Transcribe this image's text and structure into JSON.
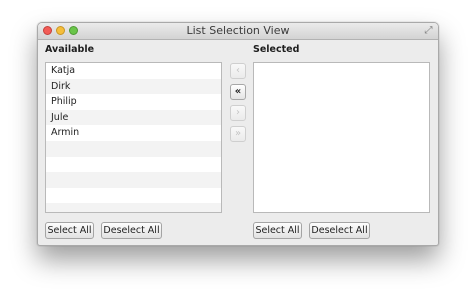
{
  "window": {
    "title": "List Selection View"
  },
  "available": {
    "heading": "Available",
    "items": [
      "Katja",
      "Dirk",
      "Philip",
      "Jule",
      "Armin"
    ],
    "select_all_label": "Select All",
    "deselect_all_label": "Deselect All"
  },
  "selected": {
    "heading": "Selected",
    "items": [],
    "select_all_label": "Select All",
    "deselect_all_label": "Deselect All"
  },
  "transfer_buttons": {
    "move_all_left": "«",
    "move_one_left": "‹",
    "move_one_right": "›",
    "move_all_right": "»"
  }
}
